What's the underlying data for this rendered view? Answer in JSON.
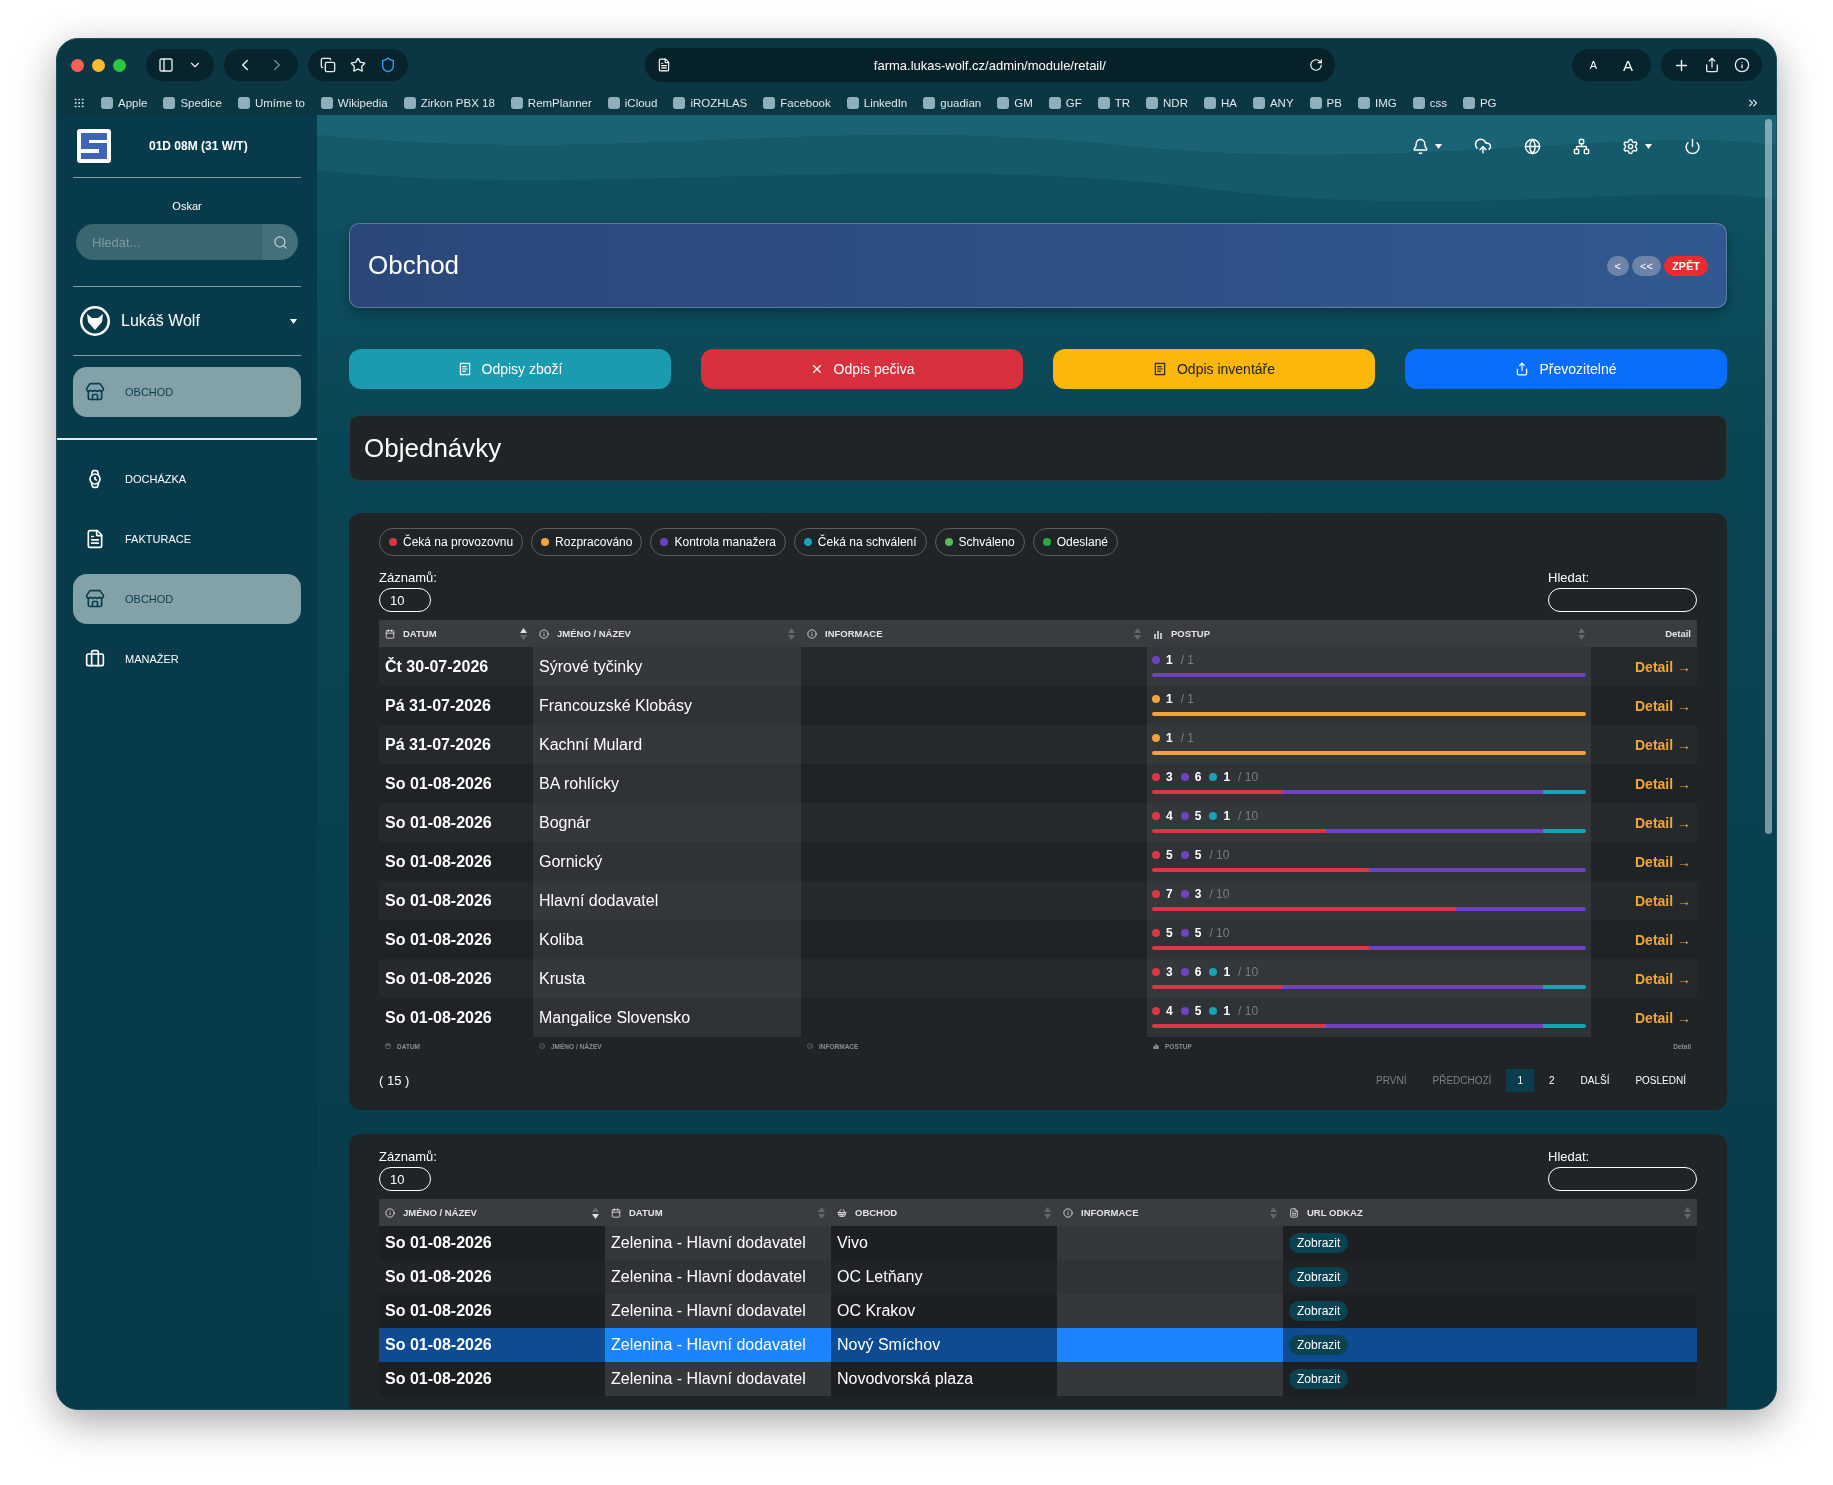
{
  "browser": {
    "address": "farma.lukas-wolf.cz/admin/module/retail/",
    "text_size": [
      "A",
      "A"
    ],
    "bookmarks": [
      "Apple",
      "Spedice",
      "Umíme to",
      "Wikipedia",
      "Zirkon PBX 18",
      "RemPlanner",
      "iCloud",
      "iROZHLAS",
      "Facebook",
      "LinkedIn",
      "guadian",
      "GM",
      "GF",
      "TR",
      "NDR",
      "HA",
      "ANY",
      "PB",
      "IMG",
      "css",
      "PG"
    ]
  },
  "sidebar": {
    "timer": "01D 08M (31 W/T)",
    "workspace": "Oskar",
    "search": {
      "placeholder": "Hledat..."
    },
    "user": "Lukáš Wolf",
    "pinned": {
      "label": "OBCHOD",
      "selected": true
    },
    "items": [
      {
        "label": "DOCHÁZKA",
        "selected": false
      },
      {
        "label": "FAKTURACE",
        "selected": false
      },
      {
        "label": "OBCHOD",
        "selected": true
      },
      {
        "label": "MANAŽER",
        "selected": false
      }
    ]
  },
  "header": {
    "title": "Obchod",
    "nav": [
      "<",
      "<<"
    ],
    "back": "ZPĚT"
  },
  "actions": [
    {
      "label": "Odpisy zboží",
      "color": "#1a9bb0"
    },
    {
      "label": "Odpis pečiva",
      "color": "#d9303e"
    },
    {
      "label": "Odpis inventáře",
      "color": "#fbb80b"
    },
    {
      "label": "Převozitelné",
      "color": "#0a6efd"
    }
  ],
  "section_title": "Objednávky",
  "orders": {
    "legend": [
      {
        "label": "Čeká na provozovnu",
        "color": "#dc3545"
      },
      {
        "label": "Rozpracováno",
        "color": "#f5a23a"
      },
      {
        "label": "Kontrola manažera",
        "color": "#6f42c1"
      },
      {
        "label": "Čeká na schválení",
        "color": "#17a2b8"
      },
      {
        "label": "Schváleno",
        "color": "#5cb85c"
      },
      {
        "label": "Odeslané",
        "color": "#28a745"
      }
    ],
    "records_label": "Záznamů:",
    "records_value": "10",
    "search_label": "Hledat:",
    "columns": [
      {
        "label": "DATUM",
        "sorted": true
      },
      {
        "label": "JMÉNO / NÁZEV",
        "sorted": false
      },
      {
        "label": "INFORMACE",
        "sorted": false
      },
      {
        "label": "POSTUP",
        "sorted": false
      },
      {
        "label": "Detail"
      }
    ],
    "rows": [
      {
        "date": "Čt 30-07-2026",
        "name": "Sýrové tyčinky",
        "total": "/ 1",
        "segments": [
          {
            "count": "1",
            "color": "#6f42c1"
          }
        ],
        "link": "Detail →"
      },
      {
        "date": "Pá 31-07-2026",
        "name": "Francouzské Klobásy",
        "total": "/ 1",
        "segments": [
          {
            "count": "1",
            "color": "#f5a23a"
          }
        ],
        "link": "Detail →"
      },
      {
        "date": "Pá 31-07-2026",
        "name": "Kachní Mulard",
        "total": "/ 1",
        "segments": [
          {
            "count": "1",
            "color": "#f5a23a"
          }
        ],
        "link": "Detail →"
      },
      {
        "date": "So 01-08-2026",
        "name": "BA rohlícky",
        "total": "/ 10",
        "segments": [
          {
            "count": "3",
            "color": "#dc3545"
          },
          {
            "count": "6",
            "color": "#6f42c1"
          },
          {
            "count": "1",
            "color": "#17a2b8"
          }
        ],
        "link": "Detail →"
      },
      {
        "date": "So 01-08-2026",
        "name": "Bognár",
        "total": "/ 10",
        "segments": [
          {
            "count": "4",
            "color": "#dc3545"
          },
          {
            "count": "5",
            "color": "#6f42c1"
          },
          {
            "count": "1",
            "color": "#17a2b8"
          }
        ],
        "link": "Detail →"
      },
      {
        "date": "So 01-08-2026",
        "name": "Gornický",
        "total": "/ 10",
        "segments": [
          {
            "count": "5",
            "color": "#dc3545"
          },
          {
            "count": "5",
            "color": "#6f42c1"
          }
        ],
        "link": "Detail →"
      },
      {
        "date": "So 01-08-2026",
        "name": "Hlavní dodavatel",
        "total": "/ 10",
        "segments": [
          {
            "count": "7",
            "color": "#dc3545"
          },
          {
            "count": "3",
            "color": "#6f42c1"
          }
        ],
        "link": "Detail →"
      },
      {
        "date": "So 01-08-2026",
        "name": "Koliba",
        "total": "/ 10",
        "segments": [
          {
            "count": "5",
            "color": "#dc3545"
          },
          {
            "count": "5",
            "color": "#6f42c1"
          }
        ],
        "link": "Detail →"
      },
      {
        "date": "So 01-08-2026",
        "name": "Krusta",
        "total": "/ 10",
        "segments": [
          {
            "count": "3",
            "color": "#dc3545"
          },
          {
            "count": "6",
            "color": "#6f42c1"
          },
          {
            "count": "1",
            "color": "#17a2b8"
          }
        ],
        "link": "Detail →"
      },
      {
        "date": "So 01-08-2026",
        "name": "Mangalice Slovensko",
        "total": "/ 10",
        "segments": [
          {
            "count": "4",
            "color": "#dc3545"
          },
          {
            "count": "5",
            "color": "#6f42c1"
          },
          {
            "count": "1",
            "color": "#17a2b8"
          }
        ],
        "link": "Detail →"
      }
    ],
    "footer_columns": [
      "DATUM",
      "JMÉNO / NÁZEV",
      "INFORMACE",
      "POSTUP",
      "Detail"
    ],
    "count": "( 15 )",
    "pagination": [
      {
        "label": "PRVNÍ",
        "selected": false,
        "disabled": true
      },
      {
        "label": "PŘEDCHOZÍ",
        "selected": false,
        "disabled": true
      },
      {
        "label": "1",
        "selected": true,
        "disabled": false
      },
      {
        "label": "2",
        "selected": false,
        "disabled": false
      },
      {
        "label": "DALŠÍ",
        "selected": false,
        "disabled": false
      },
      {
        "label": "POSLEDNÍ",
        "selected": false,
        "disabled": false
      }
    ]
  },
  "deliveries": {
    "records_label": "Záznamů:",
    "records_value": "10",
    "search_label": "Hledat:",
    "columns": [
      {
        "label": "JMÉNO / NÁZEV",
        "sorted": true
      },
      {
        "label": "DATUM",
        "sorted": false
      },
      {
        "label": "OBCHOD",
        "sorted": false
      },
      {
        "label": "INFORMACE",
        "sorted": false
      },
      {
        "label": "URL ODKAZ",
        "sorted": false
      }
    ],
    "rows": [
      {
        "date": "So 01-08-2026",
        "supplier": "Zelenina - Hlavní dodavatel",
        "shop": "Vivo",
        "link": "Zobrazit",
        "selected": false
      },
      {
        "date": "So 01-08-2026",
        "supplier": "Zelenina - Hlavní dodavatel",
        "shop": "OC Letňany",
        "link": "Zobrazit",
        "selected": false
      },
      {
        "date": "So 01-08-2026",
        "supplier": "Zelenina - Hlavní dodavatel",
        "shop": "OC Krakov",
        "link": "Zobrazit",
        "selected": false
      },
      {
        "date": "So 01-08-2026",
        "supplier": "Zelenina - Hlavní dodavatel",
        "shop": "Nový Smíchov",
        "link": "Zobrazit",
        "selected": true
      },
      {
        "date": "So 01-08-2026",
        "supplier": "Zelenina - Hlavní dodavatel",
        "shop": "Novodvorská plaza",
        "link": "Zobrazit",
        "selected": false
      }
    ]
  }
}
